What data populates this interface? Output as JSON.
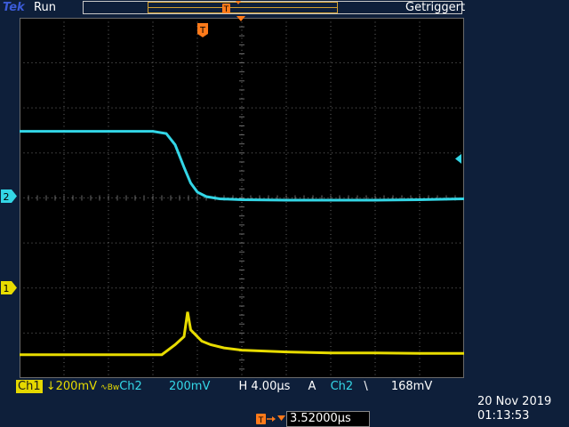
{
  "header": {
    "brand": "Tek",
    "state": "Run",
    "trigger_status": "Getriggert"
  },
  "markers": {
    "ch2": "2",
    "ch1": "1",
    "trigger": "T"
  },
  "status": {
    "ch1_label": "Ch1",
    "ch1_coupling": "↓",
    "ch1_scale": "200mV",
    "bw_symbol": "∿Bw",
    "ch2_label": "Ch2",
    "ch2_scale": "200mV",
    "horizontal_label": "H",
    "horizontal_scale": "4.00µs",
    "trigger_mode": "A",
    "trigger_source": "Ch2",
    "trigger_slope": "\\",
    "trigger_level": "168mV"
  },
  "footer": {
    "trigger_delay": "3.52000µs",
    "date": "20 Nov 2019",
    "time": "01:13:53"
  },
  "colors": {
    "ch1": "#e8dc00",
    "ch2": "#33d6e6",
    "trigger": "#ff7a1a",
    "grid": "#6a6a6a",
    "background": "#000000"
  },
  "chart_data": {
    "type": "line",
    "x_divisions": 10,
    "y_divisions": 8,
    "x_scale_per_div": "4.00µs",
    "y_scale_per_div": "200mV",
    "grid": true,
    "series": [
      {
        "name": "Ch2",
        "color": "#33d6e6",
        "x": [
          0,
          1.0,
          2.0,
          3.0,
          3.3,
          3.5,
          3.7,
          3.85,
          4.0,
          4.2,
          4.5,
          5.0,
          6.0,
          7.0,
          8.0,
          9.0,
          10.0
        ],
        "y": [
          2.4,
          2.4,
          2.4,
          2.4,
          2.35,
          2.1,
          1.6,
          1.25,
          1.05,
          0.95,
          0.9,
          0.88,
          0.87,
          0.87,
          0.87,
          0.88,
          0.9
        ]
      },
      {
        "name": "Ch1",
        "color": "#e8dc00",
        "x": [
          0,
          1.0,
          2.0,
          3.0,
          3.2,
          3.5,
          3.7,
          3.78,
          3.85,
          3.95,
          4.1,
          4.3,
          4.6,
          5.0,
          6.0,
          7.0,
          8.0,
          9.0,
          10.0
        ],
        "y": [
          0,
          0,
          0,
          0,
          0,
          0.22,
          0.4,
          0.95,
          0.55,
          0.45,
          0.3,
          0.22,
          0.15,
          0.1,
          0.06,
          0.04,
          0.04,
          0.03,
          0.03
        ]
      }
    ]
  }
}
